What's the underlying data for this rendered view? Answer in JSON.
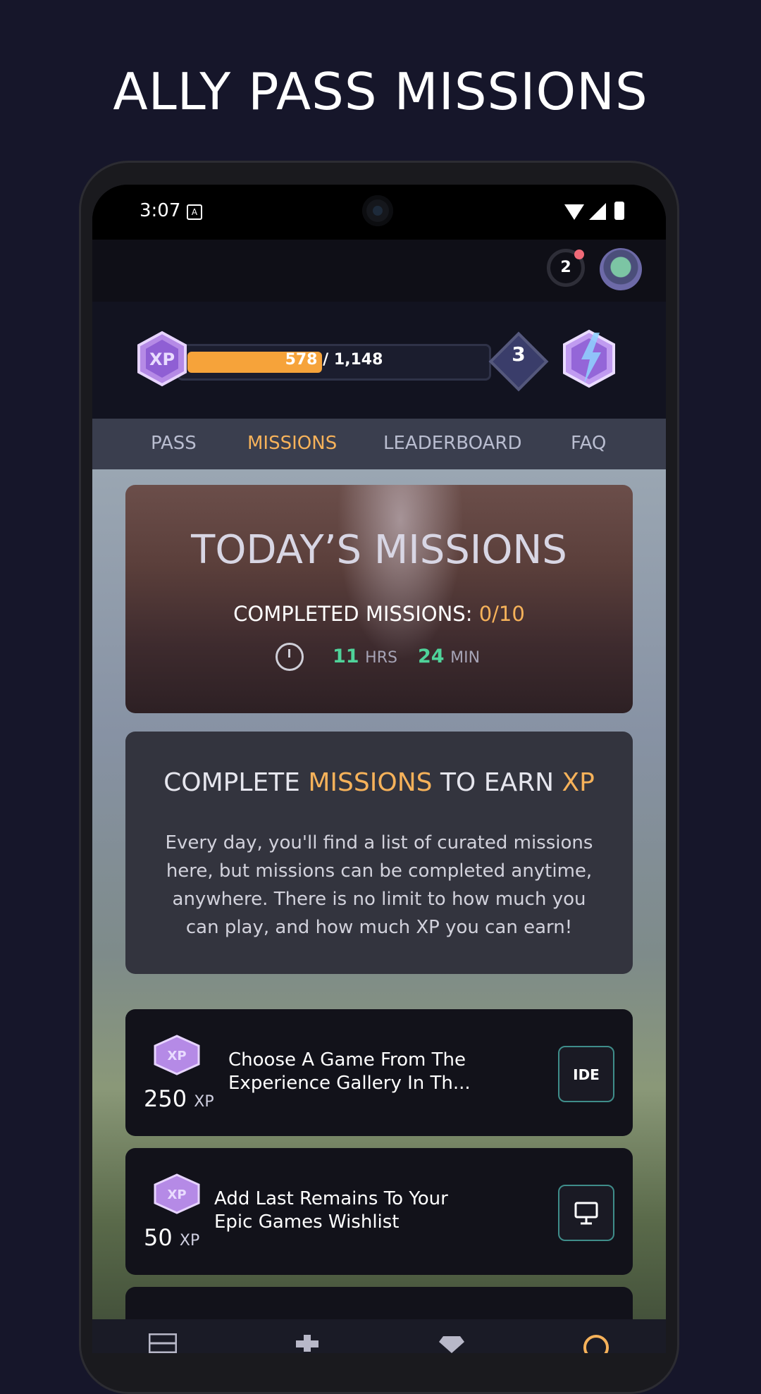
{
  "headline": "ALLY PASS MISSIONS",
  "status_bar": {
    "time": "3:07",
    "notification_icon": "a-icon"
  },
  "header": {
    "notification_count": "2"
  },
  "xp": {
    "progress_text": "578 / 1,148",
    "current": 578,
    "total": 1148,
    "level": "3",
    "badge_label": "XP"
  },
  "tabs": [
    {
      "label": "PASS",
      "active": false
    },
    {
      "label": "MISSIONS",
      "active": true
    },
    {
      "label": "LEADERBOARD",
      "active": false
    },
    {
      "label": "FAQ",
      "active": false
    }
  ],
  "hero": {
    "title": "TODAY’S MISSIONS",
    "completed_label": "COMPLETED MISSIONS:",
    "completed_value": "0/10",
    "hours": "11",
    "hours_unit": "HRS",
    "minutes": "24",
    "minutes_unit": "MIN"
  },
  "info": {
    "title_part1": "COMPLETE ",
    "title_highlight1": "MISSIONS",
    "title_part2": " TO EARN ",
    "title_highlight2": "XP",
    "body": "Every day, you'll find a list of curated missions here, but missions can be completed anytime, anywhere. There is no limit to how much you can play, and how much XP you can earn!"
  },
  "missions": [
    {
      "xp": "250",
      "xp_unit": "XP",
      "text": "Choose A Game From The Experience Gallery In Th...",
      "action_icon": "ide-logo-icon",
      "action_label": "IDE"
    },
    {
      "xp": "50",
      "xp_unit": "XP",
      "text": " Add Last Remains To Your Epic Games Wishlist",
      "action_icon": "monitor-icon"
    }
  ],
  "colors": {
    "accent": "#f6b25a",
    "timer": "#4fd39a",
    "xp_fill": "#f6a33a",
    "background": "#16162a"
  }
}
